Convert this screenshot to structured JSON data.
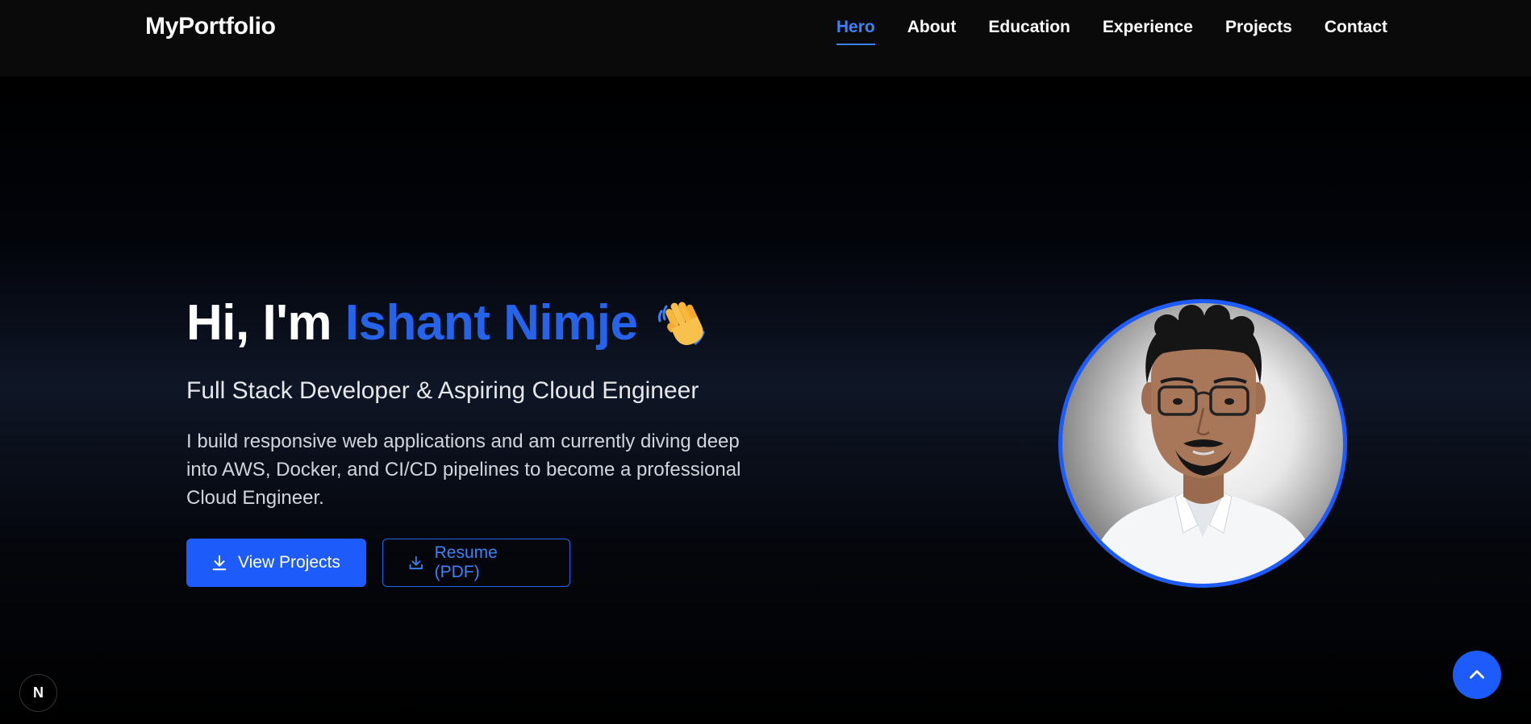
{
  "nav": {
    "logo": "MyPortfolio",
    "links": [
      {
        "label": "Hero",
        "active": true
      },
      {
        "label": "About"
      },
      {
        "label": "Education"
      },
      {
        "label": "Experience"
      },
      {
        "label": "Projects"
      },
      {
        "label": "Contact"
      }
    ]
  },
  "hero": {
    "greeting_prefix": "Hi, I'm ",
    "name": "Ishant Nimje",
    "wave_icon": "waving-hand-icon",
    "subtitle": "Full Stack Developer & Aspiring Cloud Engineer",
    "description": "I build responsive web applications and am currently diving deep into AWS, Docker, and CI/CD pipelines to become a professional Cloud Engineer.",
    "buttons": {
      "primary": {
        "label": "View Projects",
        "icon": "download-icon"
      },
      "secondary": {
        "label": "Resume (PDF)",
        "icon": "download-icon"
      }
    },
    "avatar": "profile-photo"
  },
  "floating": {
    "scroll_top_icon": "chevron-up-icon",
    "dev_badge": "N"
  },
  "colors": {
    "accent": "#2563eb",
    "button": "#1d5cfb",
    "nav_bg": "#0a0a0a",
    "page_bg": "#000000"
  }
}
